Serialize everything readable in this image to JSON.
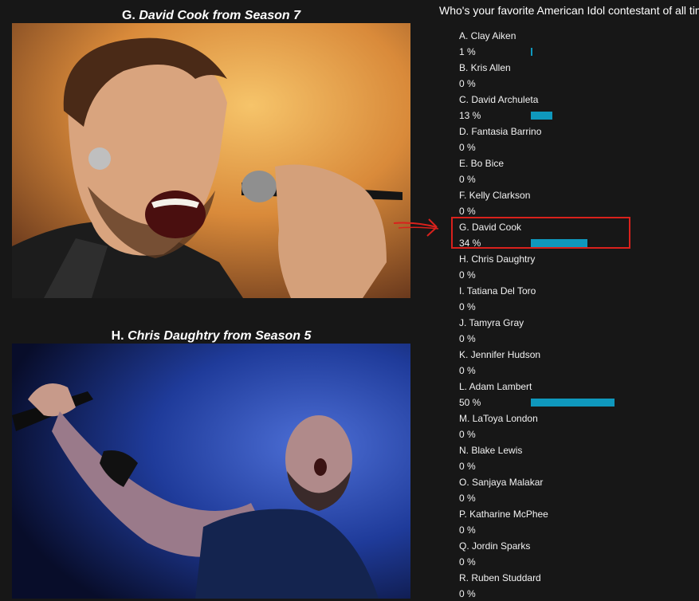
{
  "captions": {
    "g": {
      "letter": "G.",
      "title": "David Cook from Season 7"
    },
    "h": {
      "letter": "H.",
      "title": "Chris Daughtry from Season 5"
    }
  },
  "poll": {
    "question": "Who's your favorite American Idol contestant of all time?",
    "bar_color": "#0f98bd",
    "options": [
      {
        "label": "A. Clay Aiken",
        "percent_text": "1 %",
        "percent": 1
      },
      {
        "label": "B. Kris Allen",
        "percent_text": "0 %",
        "percent": 0
      },
      {
        "label": "C. David Archuleta",
        "percent_text": "13 %",
        "percent": 13
      },
      {
        "label": "D. Fantasia Barrino",
        "percent_text": "0 %",
        "percent": 0
      },
      {
        "label": "E. Bo Bice",
        "percent_text": "0 %",
        "percent": 0
      },
      {
        "label": "F. Kelly Clarkson",
        "percent_text": "0 %",
        "percent": 0
      },
      {
        "label": "G. David Cook",
        "percent_text": "34 %",
        "percent": 34,
        "highlighted": true
      },
      {
        "label": "H. Chris Daughtry",
        "percent_text": "0 %",
        "percent": 0
      },
      {
        "label": "I. Tatiana Del Toro",
        "percent_text": "0 %",
        "percent": 0
      },
      {
        "label": "J. Tamyra Gray",
        "percent_text": "0 %",
        "percent": 0
      },
      {
        "label": "K. Jennifer Hudson",
        "percent_text": "0 %",
        "percent": 0
      },
      {
        "label": "L. Adam Lambert",
        "percent_text": "50 %",
        "percent": 50
      },
      {
        "label": "M. LaToya London",
        "percent_text": "0 %",
        "percent": 0
      },
      {
        "label": "N. Blake Lewis",
        "percent_text": "0 %",
        "percent": 0
      },
      {
        "label": "O. Sanjaya Malakar",
        "percent_text": "0 %",
        "percent": 0
      },
      {
        "label": "P. Katharine McPhee",
        "percent_text": "0 %",
        "percent": 0
      },
      {
        "label": "Q. Jordin Sparks",
        "percent_text": "0 %",
        "percent": 0
      },
      {
        "label": "R. Ruben Studdard",
        "percent_text": "0 %",
        "percent": 0
      }
    ]
  },
  "annotation_color": "#d9211c"
}
